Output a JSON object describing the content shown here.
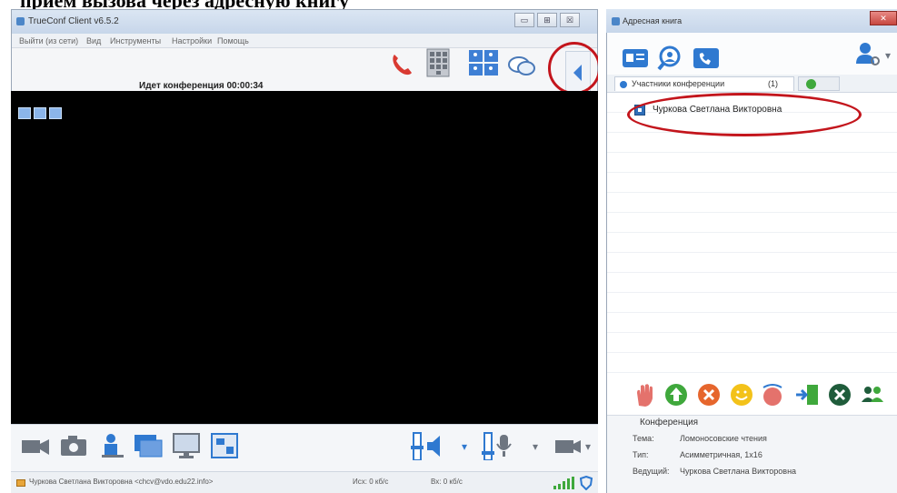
{
  "caption": "прием вызова через адресную книгу",
  "main_window": {
    "title": "TrueConf Client v6.5.2",
    "controls": {
      "minimize": "▭",
      "maximize": "⊞",
      "close": "☒"
    },
    "menu": [
      "Выйти (из сети)",
      "Вид",
      "Инструменты",
      "Настройки",
      "Помощь"
    ],
    "conference_status": "Идет конференция 00:00:34",
    "toolbar_icons": [
      "phone-hangup-icon",
      "keypad-icon",
      "layout-icon",
      "chat-icon"
    ],
    "bottom_icons_left": [
      "camera-video-icon",
      "photo-camera-icon",
      "user-card-icon",
      "window-icon",
      "screen-share-icon",
      "slideshow-icon"
    ],
    "bottom_icons_right": [
      "volume-slider-icon",
      "speaker-icon",
      "mic-slider-icon",
      "microphone-icon",
      "camera-icon"
    ],
    "statusbar": {
      "user": "Чуркова Светлана Викторовна <chcv@vdo.edu22.info>",
      "out": "Исх: 0 кб/с",
      "in": "Вх: 0 кб/с"
    }
  },
  "address_book": {
    "title": "Адресная книга",
    "toolbar_icons": [
      "contacts-icon",
      "search-user-icon",
      "phone-book-icon",
      "user-settings-icon"
    ],
    "tab_participants": {
      "label": "Участники конференции",
      "count": "(1)"
    },
    "participants": [
      "Чуркова Светлана Викторовна"
    ],
    "action_icons": [
      "raise-hand-icon",
      "promote-up-icon",
      "remove-icon",
      "smile-icon",
      "call-icon",
      "exit-icon",
      "kick-icon",
      "users-icon"
    ],
    "conference": {
      "heading": "Конференция",
      "topic_label": "Тема:",
      "topic_value": "Ломоносовские чтения",
      "type_label": "Тип:",
      "type_value": "Асимметричная, 1x16",
      "host_label": "Ведущий:",
      "host_value": "Чуркова Светлана Викторовна"
    }
  },
  "colors": {
    "accent": "#2f79d0",
    "highlight_ring": "#c3151c",
    "phone_red": "#d93a32",
    "green": "#3fa83c"
  }
}
